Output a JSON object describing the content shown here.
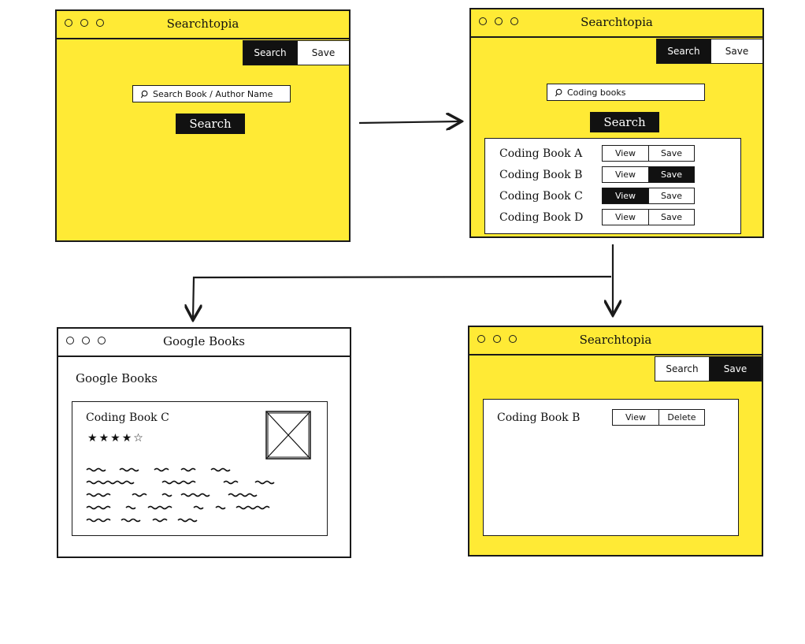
{
  "windows": {
    "w1": {
      "title": "Searchtopia",
      "tabs": {
        "search": "Search",
        "save": "Save"
      },
      "search_placeholder": "Search Book / Author Name",
      "search_button": "Search"
    },
    "w2": {
      "title": "Searchtopia",
      "tabs": {
        "search": "Search",
        "save": "Save"
      },
      "search_value": "Coding books",
      "search_button": "Search",
      "results": [
        {
          "name": "Coding Book A",
          "view": "View",
          "save": "Save"
        },
        {
          "name": "Coding Book B",
          "view": "View",
          "save": "Save"
        },
        {
          "name": "Coding Book C",
          "view": "View",
          "save": "Save"
        },
        {
          "name": "Coding Book D",
          "view": "View",
          "save": "Save"
        }
      ]
    },
    "w3": {
      "title": "Google Books",
      "heading": "Google Books",
      "book_title": "Coding Book C",
      "rating": 4,
      "rating_max": 5
    },
    "w4": {
      "title": "Searchtopia",
      "tabs": {
        "search": "Search",
        "save": "Save"
      },
      "saved": [
        {
          "name": "Coding Book B",
          "view": "View",
          "delete": "Delete"
        }
      ]
    }
  },
  "colors": {
    "accent": "#ffea35",
    "ink": "#111111"
  },
  "icons": {
    "search": "magnifier-icon",
    "cover_placeholder": "image-placeholder-icon",
    "star": "star-icon"
  }
}
